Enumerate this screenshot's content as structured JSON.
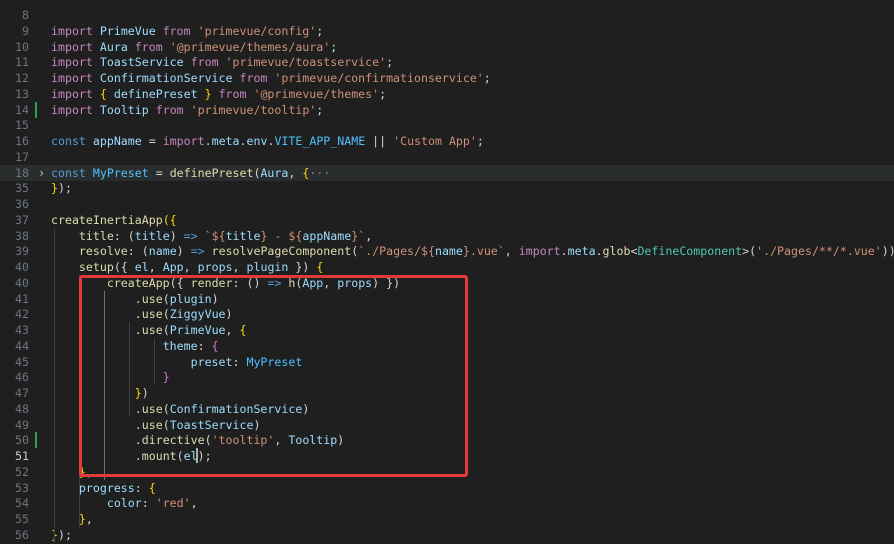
{
  "editor": {
    "top_fragment": "··· ·· ··· · ··· ···",
    "colors": {
      "background": "#1f1f1f",
      "keyword": "#c586c0",
      "storage": "#569cd6",
      "string": "#ce9178",
      "variable": "#9cdcfe",
      "class": "#4ec9b0",
      "function": "#dcdcaa",
      "constant": "#4fc1ff",
      "punctuation": "#d4d4d4",
      "line_number": "#6e7681",
      "highlight_box": "#e03b3b",
      "git_added": "#2ea043"
    },
    "active_line": "51",
    "lines": [
      {
        "num": "8",
        "tokens": []
      },
      {
        "num": "9",
        "tokens": [
          {
            "t": "import",
            "c": "keyword"
          },
          {
            "t": " "
          },
          {
            "t": "PrimeVue",
            "c": "var"
          },
          {
            "t": " "
          },
          {
            "t": "from",
            "c": "keyword"
          },
          {
            "t": " "
          },
          {
            "t": "'primevue/config'",
            "c": "str"
          },
          {
            "t": ";"
          }
        ]
      },
      {
        "num": "10",
        "tokens": [
          {
            "t": "import",
            "c": "keyword"
          },
          {
            "t": " "
          },
          {
            "t": "Aura",
            "c": "var"
          },
          {
            "t": " "
          },
          {
            "t": "from",
            "c": "keyword"
          },
          {
            "t": " "
          },
          {
            "t": "'@primevue/themes/aura'",
            "c": "str"
          },
          {
            "t": ";"
          }
        ]
      },
      {
        "num": "11",
        "tokens": [
          {
            "t": "import",
            "c": "keyword"
          },
          {
            "t": " "
          },
          {
            "t": "ToastService",
            "c": "var"
          },
          {
            "t": " "
          },
          {
            "t": "from",
            "c": "keyword"
          },
          {
            "t": " "
          },
          {
            "t": "'primevue/toastservice'",
            "c": "str"
          },
          {
            "t": ";"
          }
        ]
      },
      {
        "num": "12",
        "tokens": [
          {
            "t": "import",
            "c": "keyword"
          },
          {
            "t": " "
          },
          {
            "t": "ConfirmationService",
            "c": "var"
          },
          {
            "t": " "
          },
          {
            "t": "from",
            "c": "keyword"
          },
          {
            "t": " "
          },
          {
            "t": "'primevue/confirmationservice'",
            "c": "str"
          },
          {
            "t": ";"
          }
        ]
      },
      {
        "num": "13",
        "tokens": [
          {
            "t": "import",
            "c": "keyword"
          },
          {
            "t": " "
          },
          {
            "t": "{",
            "c": "brace"
          },
          {
            "t": " "
          },
          {
            "t": "definePreset",
            "c": "var"
          },
          {
            "t": " "
          },
          {
            "t": "}",
            "c": "brace"
          },
          {
            "t": " "
          },
          {
            "t": "from",
            "c": "keyword"
          },
          {
            "t": " "
          },
          {
            "t": "'@primevue/themes'",
            "c": "str"
          },
          {
            "t": ";"
          }
        ]
      },
      {
        "num": "14",
        "git": "added",
        "tokens": [
          {
            "t": "import",
            "c": "keyword"
          },
          {
            "t": " "
          },
          {
            "t": "Tooltip",
            "c": "var"
          },
          {
            "t": " "
          },
          {
            "t": "from",
            "c": "keyword"
          },
          {
            "t": " "
          },
          {
            "t": "'primevue/tooltip'",
            "c": "str"
          },
          {
            "t": ";"
          }
        ]
      },
      {
        "num": "15",
        "tokens": []
      },
      {
        "num": "16",
        "tokens": [
          {
            "t": "const",
            "c": "storage"
          },
          {
            "t": " "
          },
          {
            "t": "appName",
            "c": "var"
          },
          {
            "t": " = "
          },
          {
            "t": "import",
            "c": "keyword"
          },
          {
            "t": "."
          },
          {
            "t": "meta",
            "c": "var"
          },
          {
            "t": "."
          },
          {
            "t": "env",
            "c": "var"
          },
          {
            "t": "."
          },
          {
            "t": "VITE_APP_NAME",
            "c": "const"
          },
          {
            "t": " || "
          },
          {
            "t": "'Custom App'",
            "c": "str"
          },
          {
            "t": ";"
          }
        ]
      },
      {
        "num": "17",
        "tokens": []
      },
      {
        "num": "18",
        "highlight": true,
        "fold": "›",
        "tokens": [
          {
            "t": "const",
            "c": "storage"
          },
          {
            "t": " "
          },
          {
            "t": "MyPreset",
            "c": "const"
          },
          {
            "t": " = "
          },
          {
            "t": "definePreset",
            "c": "fn"
          },
          {
            "t": "("
          },
          {
            "t": "Aura",
            "c": "var"
          },
          {
            "t": ", "
          },
          {
            "t": "{",
            "c": "brace"
          },
          {
            "t": "···",
            "c": "dim"
          }
        ]
      },
      {
        "num": "35",
        "tokens": [
          {
            "t": "}",
            "c": "brace"
          },
          {
            "t": ");"
          }
        ]
      },
      {
        "num": "36",
        "tokens": []
      },
      {
        "num": "37",
        "tokens": [
          {
            "t": "createInertiaApp",
            "c": "fn"
          },
          {
            "t": "({",
            "c": "brace"
          }
        ]
      },
      {
        "num": "38",
        "tokens": [
          {
            "t": "    "
          },
          {
            "t": "title",
            "c": "fn"
          },
          {
            "t": ": ("
          },
          {
            "t": "title",
            "c": "var"
          },
          {
            "t": ") "
          },
          {
            "t": "=>",
            "c": "storage"
          },
          {
            "t": " "
          },
          {
            "t": "`${",
            "c": "str"
          },
          {
            "t": "title",
            "c": "var"
          },
          {
            "t": "} - ${",
            "c": "str"
          },
          {
            "t": "appName",
            "c": "var"
          },
          {
            "t": "}`",
            "c": "str"
          },
          {
            "t": ","
          }
        ]
      },
      {
        "num": "39",
        "tokens": [
          {
            "t": "    "
          },
          {
            "t": "resolve",
            "c": "fn"
          },
          {
            "t": ": ("
          },
          {
            "t": "name",
            "c": "var"
          },
          {
            "t": ") "
          },
          {
            "t": "=>",
            "c": "storage"
          },
          {
            "t": " "
          },
          {
            "t": "resolvePageComponent",
            "c": "fn"
          },
          {
            "t": "("
          },
          {
            "t": "`./Pages/${",
            "c": "str"
          },
          {
            "t": "name",
            "c": "var"
          },
          {
            "t": "}.vue`",
            "c": "str"
          },
          {
            "t": ", "
          },
          {
            "t": "import",
            "c": "keyword"
          },
          {
            "t": "."
          },
          {
            "t": "meta",
            "c": "var"
          },
          {
            "t": "."
          },
          {
            "t": "glob",
            "c": "fn"
          },
          {
            "t": "<"
          },
          {
            "t": "DefineComponent",
            "c": "class"
          },
          {
            "t": ">("
          },
          {
            "t": "'./Pages/**/*.vue'",
            "c": "str"
          },
          {
            "t": ")),"
          }
        ]
      },
      {
        "num": "40",
        "tokens": [
          {
            "t": "    "
          },
          {
            "t": "setup",
            "c": "fn"
          },
          {
            "t": "({ "
          },
          {
            "t": "el",
            "c": "var"
          },
          {
            "t": ", "
          },
          {
            "t": "App",
            "c": "var"
          },
          {
            "t": ", "
          },
          {
            "t": "props",
            "c": "var"
          },
          {
            "t": ", "
          },
          {
            "t": "plugin",
            "c": "var"
          },
          {
            "t": " }) "
          },
          {
            "t": "{",
            "c": "brace"
          }
        ]
      },
      {
        "num": "40",
        "tokens": [
          {
            "t": "        "
          },
          {
            "t": "createApp",
            "c": "fn"
          },
          {
            "t": "({ "
          },
          {
            "t": "render",
            "c": "fn"
          },
          {
            "t": ": () "
          },
          {
            "t": "=>",
            "c": "storage"
          },
          {
            "t": " "
          },
          {
            "t": "h",
            "c": "fn"
          },
          {
            "t": "("
          },
          {
            "t": "App",
            "c": "var"
          },
          {
            "t": ", "
          },
          {
            "t": "props",
            "c": "var"
          },
          {
            "t": ") })"
          }
        ]
      },
      {
        "num": "41",
        "tokens": [
          {
            "t": "            ."
          },
          {
            "t": "use",
            "c": "fn"
          },
          {
            "t": "("
          },
          {
            "t": "plugin",
            "c": "var"
          },
          {
            "t": ")"
          }
        ]
      },
      {
        "num": "42",
        "tokens": [
          {
            "t": "            ."
          },
          {
            "t": "use",
            "c": "fn"
          },
          {
            "t": "("
          },
          {
            "t": "ZiggyVue",
            "c": "var"
          },
          {
            "t": ")"
          }
        ]
      },
      {
        "num": "43",
        "tokens": [
          {
            "t": "            ."
          },
          {
            "t": "use",
            "c": "fn"
          },
          {
            "t": "("
          },
          {
            "t": "PrimeVue",
            "c": "var"
          },
          {
            "t": ", "
          },
          {
            "t": "{",
            "c": "brace"
          }
        ]
      },
      {
        "num": "44",
        "tokens": [
          {
            "t": "                "
          },
          {
            "t": "theme",
            "c": "var"
          },
          {
            "t": ": "
          },
          {
            "t": "{",
            "c": "brace2"
          }
        ]
      },
      {
        "num": "45",
        "tokens": [
          {
            "t": "                    "
          },
          {
            "t": "preset",
            "c": "var"
          },
          {
            "t": ": "
          },
          {
            "t": "MyPreset",
            "c": "const"
          }
        ]
      },
      {
        "num": "46",
        "tokens": [
          {
            "t": "                "
          },
          {
            "t": "}",
            "c": "brace2"
          }
        ]
      },
      {
        "num": "47",
        "tokens": [
          {
            "t": "            "
          },
          {
            "t": "}",
            "c": "brace"
          },
          {
            "t": ")"
          }
        ]
      },
      {
        "num": "48",
        "tokens": [
          {
            "t": "            ."
          },
          {
            "t": "use",
            "c": "fn"
          },
          {
            "t": "("
          },
          {
            "t": "ConfirmationService",
            "c": "var"
          },
          {
            "t": ")"
          }
        ]
      },
      {
        "num": "49",
        "tokens": [
          {
            "t": "            ."
          },
          {
            "t": "use",
            "c": "fn"
          },
          {
            "t": "("
          },
          {
            "t": "ToastService",
            "c": "var"
          },
          {
            "t": ")"
          }
        ]
      },
      {
        "num": "50",
        "git": "added",
        "tokens": [
          {
            "t": "            ."
          },
          {
            "t": "directive",
            "c": "fn"
          },
          {
            "t": "("
          },
          {
            "t": "'tooltip'",
            "c": "str"
          },
          {
            "t": ", "
          },
          {
            "t": "Tooltip",
            "c": "var"
          },
          {
            "t": ")"
          }
        ]
      },
      {
        "num": "51",
        "active": true,
        "tokens": [
          {
            "t": "            ."
          },
          {
            "t": "mount",
            "c": "fn"
          },
          {
            "t": "("
          },
          {
            "t": "el",
            "c": "var"
          },
          {
            "t": ");"
          }
        ]
      },
      {
        "num": "52",
        "tokens": [
          {
            "t": "    "
          },
          {
            "t": "}",
            "c": "brace"
          },
          {
            "t": ","
          }
        ]
      },
      {
        "num": "53",
        "tokens": [
          {
            "t": "    "
          },
          {
            "t": "progress",
            "c": "var"
          },
          {
            "t": ": "
          },
          {
            "t": "{",
            "c": "brace"
          }
        ]
      },
      {
        "num": "54",
        "tokens": [
          {
            "t": "        "
          },
          {
            "t": "color",
            "c": "var"
          },
          {
            "t": ": "
          },
          {
            "t": "'red'",
            "c": "str"
          },
          {
            "t": ","
          }
        ]
      },
      {
        "num": "55",
        "tokens": [
          {
            "t": "    "
          },
          {
            "t": "}",
            "c": "brace"
          },
          {
            "t": ","
          }
        ]
      },
      {
        "num": "56",
        "tokens": [
          {
            "t": "}",
            "c": "brace"
          },
          {
            "t": ");"
          }
        ]
      }
    ]
  }
}
